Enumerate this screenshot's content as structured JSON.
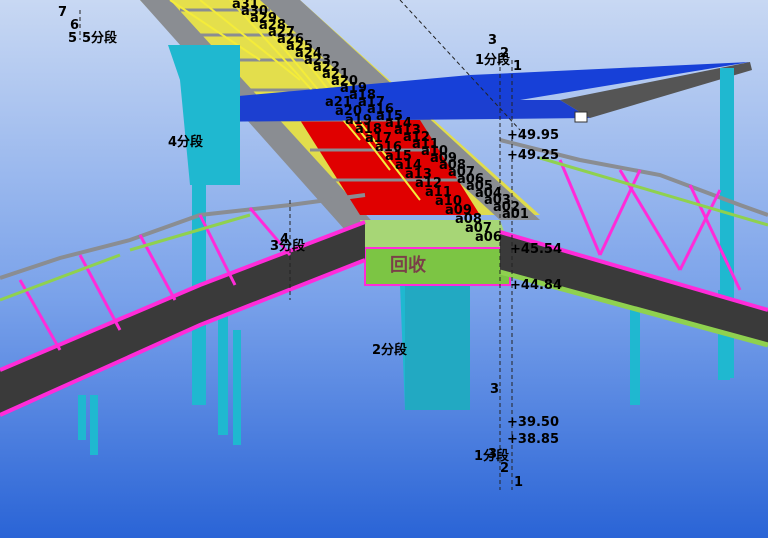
{
  "viewport": {
    "background_top": "#c7d7f2",
    "background_bottom": "#2a64d6",
    "colors": {
      "cyan_column": "#1fb8d0",
      "grey_steel": "#8a8d92",
      "magenta_brace": "#ff2bd9",
      "yellow_truss": "#f4ec3a",
      "blue_roof": "#1740d8",
      "red_core": "#e00000",
      "green_deck": "#8fd14f",
      "dark_stair": "#3a3a3a"
    }
  },
  "segment_labels": {
    "s1_top": "1分段",
    "s2_top": "2",
    "s3_top": "3",
    "s1_top_num": "1",
    "s4": "4分段",
    "s2_mid": "2分段",
    "s3_mid": "3分段",
    "s4_mid": "4",
    "s5": "5分段",
    "s5b": "5",
    "s6": "6",
    "s7": "7",
    "s3_bot": "3",
    "s1_bot": "1分段",
    "s3_bot2": "3",
    "s2_bot": "2",
    "s1_bot_num": "1"
  },
  "upper_node_labels": [
    "a31",
    "a30",
    "a29",
    "a28",
    "a27",
    "a26",
    "a25",
    "a24",
    "a23",
    "a22",
    "a21",
    "a20",
    "a19",
    "a18",
    "a17",
    "a16",
    "a15",
    "a14",
    "a13",
    "a12",
    "a11",
    "a10",
    "a09",
    "a08",
    "a07",
    "a06",
    "a05",
    "a04",
    "a03",
    "a02",
    "a01"
  ],
  "lower_node_labels": [
    "a21",
    "a20",
    "a19",
    "a18",
    "a17",
    "a16",
    "a15",
    "a14",
    "a13",
    "a12",
    "a11",
    "a10",
    "a09",
    "a08",
    "a07",
    "a06"
  ],
  "elevations": {
    "e1": "+49.95",
    "e2": "+49.25",
    "e3": "+45.54",
    "e4": "+44.84",
    "e5": "+39.50",
    "e6": "+38.85"
  },
  "sign_text": "回收"
}
